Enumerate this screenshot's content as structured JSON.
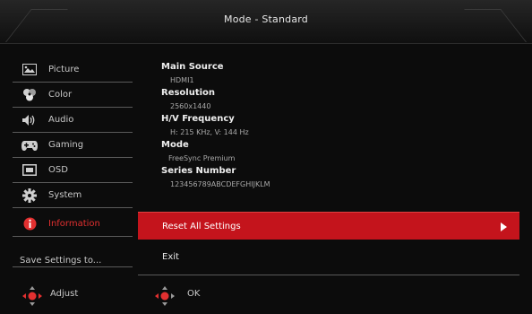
{
  "header": {
    "title": "Mode - Standard"
  },
  "sidebar": {
    "items": [
      {
        "label": "Picture",
        "icon": "picture-icon"
      },
      {
        "label": "Color",
        "icon": "palette-icon"
      },
      {
        "label": "Audio",
        "icon": "speaker-icon"
      },
      {
        "label": "Gaming",
        "icon": "gamepad-icon"
      },
      {
        "label": "OSD",
        "icon": "osd-icon"
      },
      {
        "label": "System",
        "icon": "gear-icon"
      },
      {
        "label": "Information",
        "icon": "info-icon",
        "active": true
      }
    ],
    "save_label": "Save Settings to..."
  },
  "info": {
    "main_source_label": "Main Source",
    "main_source_value": "HDMI1",
    "resolution_label": "Resolution",
    "resolution_value": "2560x1440",
    "frequency_label": "H/V Frequency",
    "frequency_value": "H: 215 KHz, V: 144 Hz",
    "mode_label": "Mode",
    "mode_value": "FreeSync Premium",
    "series_label": "Series Number",
    "series_value": "123456789ABCDEFGHIJKLM"
  },
  "actions": {
    "reset_label": "Reset All Settings",
    "exit_label": "Exit"
  },
  "footer": {
    "adjust_label": "Adjust",
    "ok_label": "OK"
  },
  "colors": {
    "accent": "#c4141c",
    "active_text": "#e23030",
    "background": "#0c0c0c"
  }
}
